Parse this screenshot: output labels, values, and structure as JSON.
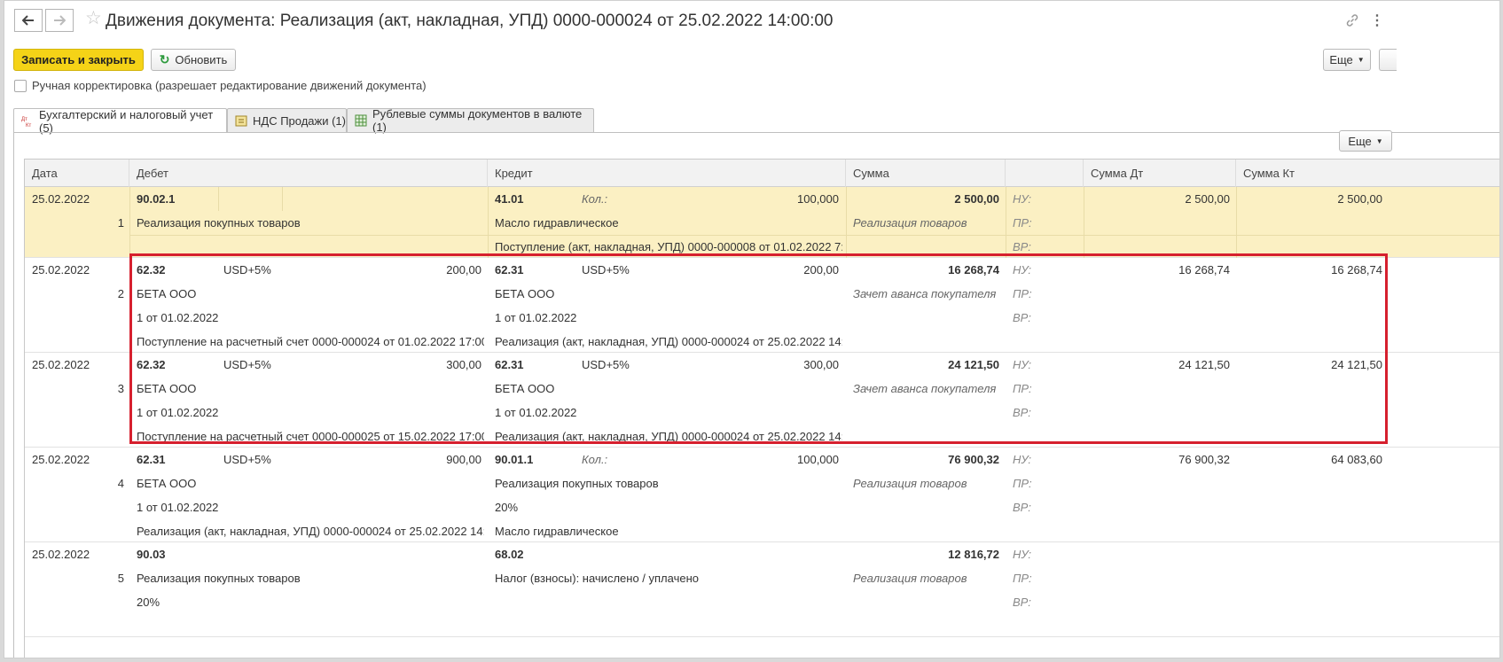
{
  "window": {
    "title": "Движения документа: Реализация (акт, накладная, УПД) 0000-000024 от 25.02.2022 14:00:00"
  },
  "toolbar": {
    "save_close": "Записать и закрыть",
    "refresh": "Обновить",
    "more": "Еще"
  },
  "manual_correction": "Ручная корректировка (разрешает редактирование движений документа)",
  "tabs": [
    {
      "label": "Бухгалтерский и налоговый учет (5)",
      "icon": "dt-kt-icon"
    },
    {
      "label": "НДС Продажи (1)",
      "icon": "register-icon"
    },
    {
      "label": "Рублевые суммы документов в валюте (1)",
      "icon": "table-icon"
    }
  ],
  "table": {
    "more": "Еще",
    "columns": [
      "Дата",
      "Дебет",
      "Кредит",
      "Сумма",
      "",
      "Сумма Дт",
      "Сумма Кт"
    ],
    "rows": [
      {
        "date": "25.02.2022",
        "num": "1",
        "debit": {
          "account": "90.02.1",
          "currency": "",
          "qty_label": "",
          "amount": "",
          "lines": [
            "Реализация покупных товаров",
            "",
            ""
          ]
        },
        "credit": {
          "account": "41.01",
          "currency": "",
          "qty_label": "Кол.:",
          "amount": "100,000",
          "lines": [
            "Масло гидравлическое",
            "Поступление (акт, накладная, УПД) 0000-000008 от 01.02.2022 7:...",
            ""
          ]
        },
        "sum": "2 500,00",
        "content": "Реализация товаров",
        "tax_labels": [
          "НУ:",
          "ПР:",
          "ВР:"
        ],
        "sum_dt": "2 500,00",
        "sum_kt": "2 500,00"
      },
      {
        "date": "25.02.2022",
        "num": "2",
        "debit": {
          "account": "62.32",
          "currency": "USD+5%",
          "qty_label": "",
          "amount": "200,00",
          "lines": [
            "БЕТА ООО",
            "1 от 01.02.2022",
            "Поступление на расчетный счет 0000-000024 от 01.02.2022 17:00..."
          ]
        },
        "credit": {
          "account": "62.31",
          "currency": "USD+5%",
          "qty_label": "",
          "amount": "200,00",
          "lines": [
            "БЕТА ООО",
            "1 от 01.02.2022",
            "Реализация (акт, накладная, УПД) 0000-000024 от 25.02.2022 14:..."
          ]
        },
        "sum": "16 268,74",
        "content": "Зачет аванса покупателя",
        "tax_labels": [
          "НУ:",
          "ПР:",
          "ВР:"
        ],
        "sum_dt": "16 268,74",
        "sum_kt": "16 268,74"
      },
      {
        "date": "25.02.2022",
        "num": "3",
        "debit": {
          "account": "62.32",
          "currency": "USD+5%",
          "qty_label": "",
          "amount": "300,00",
          "lines": [
            "БЕТА ООО",
            "1 от 01.02.2022",
            "Поступление на расчетный счет 0000-000025 от 15.02.2022 17:00..."
          ]
        },
        "credit": {
          "account": "62.31",
          "currency": "USD+5%",
          "qty_label": "",
          "amount": "300,00",
          "lines": [
            "БЕТА ООО",
            "1 от 01.02.2022",
            "Реализация (акт, накладная, УПД) 0000-000024 от 25.02.2022 14:..."
          ]
        },
        "sum": "24 121,50",
        "content": "Зачет аванса покупателя",
        "tax_labels": [
          "НУ:",
          "ПР:",
          "ВР:"
        ],
        "sum_dt": "24 121,50",
        "sum_kt": "24 121,50"
      },
      {
        "date": "25.02.2022",
        "num": "4",
        "debit": {
          "account": "62.31",
          "currency": "USD+5%",
          "qty_label": "",
          "amount": "900,00",
          "lines": [
            "БЕТА ООО",
            "1 от 01.02.2022",
            "Реализация (акт, накладная, УПД) 0000-000024 от 25.02.2022 14:..."
          ]
        },
        "credit": {
          "account": "90.01.1",
          "currency": "",
          "qty_label": "Кол.:",
          "amount": "100,000",
          "lines": [
            "Реализация покупных товаров",
            "20%",
            "Масло гидравлическое"
          ]
        },
        "sum": "76 900,32",
        "content": "Реализация товаров",
        "tax_labels": [
          "НУ:",
          "ПР:",
          "ВР:"
        ],
        "sum_dt": "76 900,32",
        "sum_kt": "64 083,60"
      },
      {
        "date": "25.02.2022",
        "num": "5",
        "debit": {
          "account": "90.03",
          "currency": "",
          "qty_label": "",
          "amount": "",
          "lines": [
            "Реализация покупных товаров",
            "20%",
            ""
          ]
        },
        "credit": {
          "account": "68.02",
          "currency": "",
          "qty_label": "",
          "amount": "",
          "lines": [
            "Налог (взносы): начислено / уплачено",
            "",
            ""
          ]
        },
        "sum": "12 816,72",
        "content": "Реализация товаров",
        "tax_labels": [
          "НУ:",
          "ПР:",
          "ВР:"
        ],
        "sum_dt": "",
        "sum_kt": ""
      }
    ]
  },
  "colors": {
    "selected_row": "#fbf0c3",
    "highlight_border": "#d6202e",
    "primary_button": "#f5d317"
  }
}
